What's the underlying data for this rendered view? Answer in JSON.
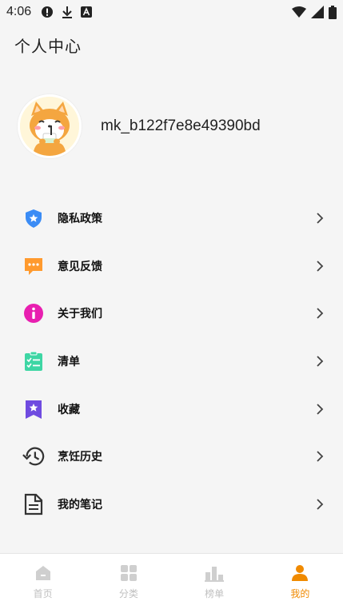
{
  "status_bar": {
    "time": "4:06",
    "icons_left": [
      "alert-icon",
      "download-icon",
      "font-icon"
    ],
    "icons_right": [
      "wifi-icon",
      "signal-icon",
      "battery-icon"
    ]
  },
  "header": {
    "title": "个人中心"
  },
  "profile": {
    "username": "mk_b122f7e8e49390bd",
    "avatar": "shiba-dog-avatar"
  },
  "menu": {
    "items": [
      {
        "label": "隐私政策",
        "icon": "shield-star-icon",
        "color": "#3b8cf5"
      },
      {
        "label": "意见反馈",
        "icon": "chat-bubble-icon",
        "color": "#ff9a2e"
      },
      {
        "label": "关于我们",
        "icon": "info-icon",
        "color": "#e81fb0"
      },
      {
        "label": "清单",
        "icon": "checklist-icon",
        "color": "#3ed6a4"
      },
      {
        "label": "收藏",
        "icon": "bookmark-star-icon",
        "color": "#6f4be0"
      },
      {
        "label": "烹饪历史",
        "icon": "history-icon",
        "color": "#333333"
      },
      {
        "label": "我的笔记",
        "icon": "note-icon",
        "color": "#333333"
      }
    ]
  },
  "bottom_nav": {
    "items": [
      {
        "label": "首页",
        "icon": "home-icon",
        "active": false
      },
      {
        "label": "分类",
        "icon": "grid-icon",
        "active": false
      },
      {
        "label": "榜单",
        "icon": "ranking-icon",
        "active": false
      },
      {
        "label": "我的",
        "icon": "person-icon",
        "active": true
      }
    ],
    "active_color": "#f08a00",
    "inactive_color": "#c0c0c0"
  }
}
